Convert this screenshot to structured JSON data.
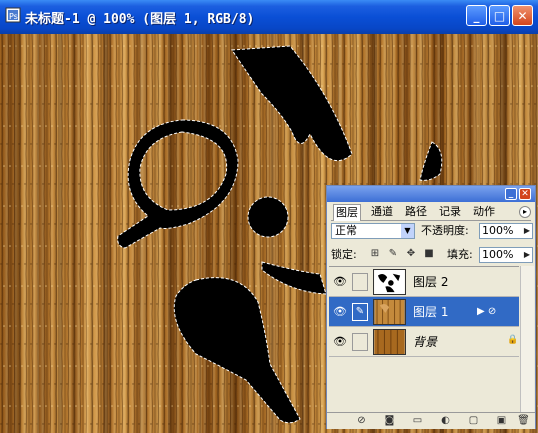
{
  "window": {
    "title": "未标题-1 @ 100% (图层 1, RGB/8)",
    "app_icon": "photoshop-document-icon",
    "buttons": {
      "minimize": "minimize-icon",
      "maximize": "maximize-icon",
      "close": "close-icon"
    }
  },
  "canvas": {
    "content": "wood texture with carved key shape selection",
    "wood_color": "#b57a2e"
  },
  "layers_palette": {
    "tabs": [
      {
        "label": "图层",
        "active": true
      },
      {
        "label": "通道",
        "active": false
      },
      {
        "label": "路径",
        "active": false
      },
      {
        "label": "记录",
        "active": false
      },
      {
        "label": "动作",
        "active": false
      }
    ],
    "blend_mode": "正常",
    "opacity_label": "不透明度:",
    "opacity_value": "100%",
    "lock_label": "锁定:",
    "fill_label": "填充:",
    "fill_value": "100%",
    "layers": [
      {
        "name": "图层 2",
        "visible": true,
        "selected": false,
        "italic": false
      },
      {
        "name": "图层 1",
        "visible": true,
        "selected": true,
        "italic": false,
        "has_effects": true
      },
      {
        "name": "背景",
        "visible": true,
        "selected": false,
        "italic": true,
        "locked": true
      }
    ],
    "bottom_icons": [
      "link-layers-icon",
      "add-style-icon",
      "add-mask-icon",
      "new-group-icon",
      "adjustment-layer-icon",
      "new-layer-icon",
      "delete-layer-icon"
    ]
  },
  "colors": {
    "titlebar": "#0a4fd6",
    "selection": "#316ac5",
    "palette_bg": "#ece9d8"
  }
}
